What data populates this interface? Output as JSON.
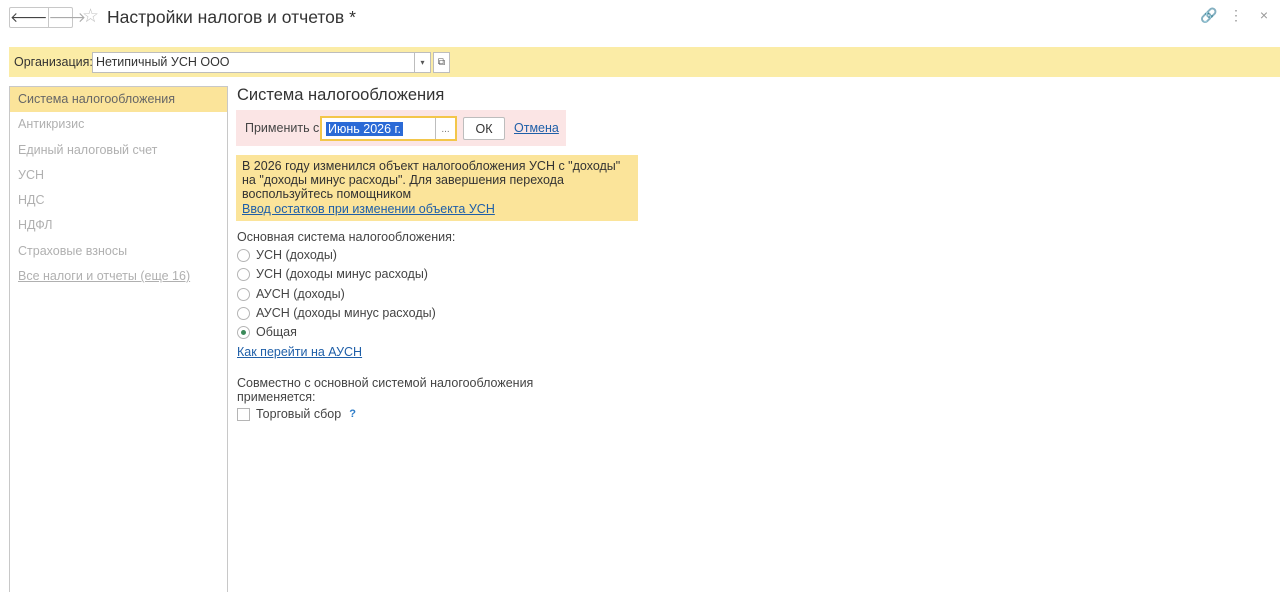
{
  "window": {
    "title": "Настройки налогов и отчетов *",
    "back_icon": "🡐",
    "forward_icon": "🡒",
    "favorite_icon": "☆",
    "link_icon": "🔗",
    "more_icon": "⋮",
    "close_icon": "×"
  },
  "org_bar": {
    "label": "Организация:",
    "value": "Нетипичный УСН ООО",
    "drop_icon": "▾",
    "open_icon": "⧉"
  },
  "sidebar": {
    "items": [
      {
        "label": "Система налогообложения"
      },
      {
        "label": "Антикризис"
      },
      {
        "label": "Единый налоговый счет"
      },
      {
        "label": "УСН"
      },
      {
        "label": "НДС"
      },
      {
        "label": "НДФЛ"
      },
      {
        "label": "Страховые взносы"
      },
      {
        "label": "Все налоги и отчеты (еще 16)"
      }
    ],
    "active_index": 0
  },
  "main": {
    "section_title": "Система налогообложения",
    "apply": {
      "label": "Применить с:",
      "value": "Июнь 2026 г.",
      "dots": "...",
      "ok": "ОК",
      "cancel": "Отмена"
    },
    "notice": {
      "text": "В 2026 году изменился объект налогообложения УСН с \"доходы\" на \"доходы минус расходы\". Для завершения перехода воспользуйтесь помощником",
      "link": "Ввод остатков при изменении объекта УСН"
    },
    "tax_system": {
      "label": "Основная система налогообложения:",
      "options": [
        {
          "label": "УСН (доходы)",
          "checked": false
        },
        {
          "label": "УСН (доходы минус расходы)",
          "checked": false
        },
        {
          "label": "АУСН (доходы)",
          "checked": false
        },
        {
          "label": "АУСН (доходы минус расходы)",
          "checked": false
        },
        {
          "label": "Общая",
          "checked": true
        }
      ],
      "help_link": "Как перейти на АУСН"
    },
    "combined": {
      "label": "Совместно с основной системой налогообложения применяется:",
      "checkbox_label": "Торговый сбор",
      "checkbox_checked": false,
      "help": "?"
    }
  }
}
